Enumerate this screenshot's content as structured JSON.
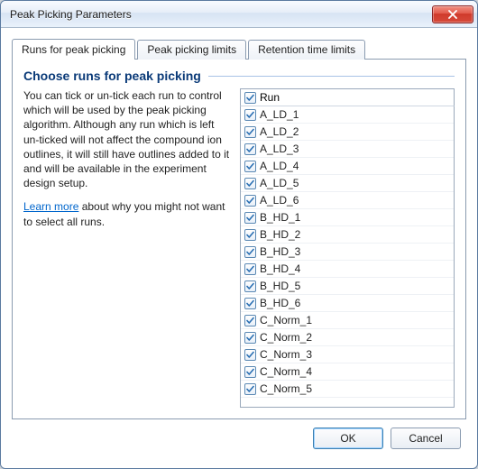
{
  "window": {
    "title": "Peak Picking Parameters"
  },
  "tabs": [
    {
      "label": "Runs for peak picking",
      "active": true
    },
    {
      "label": "Peak picking limits",
      "active": false
    },
    {
      "label": "Retention time limits",
      "active": false
    }
  ],
  "content": {
    "heading": "Choose runs for peak picking",
    "description": "You can tick or un-tick each run to control which will be used by the peak picking algorithm. Although any run which is left un-ticked will not affect the compound ion outlines, it will still have outlines added to it and will be available in the experiment design setup.",
    "learn_more_label": "Learn more",
    "learn_more_suffix": " about why you might not want to select all runs."
  },
  "list": {
    "header_label": "Run",
    "header_checked": true,
    "items": [
      {
        "label": "A_LD_1",
        "checked": true
      },
      {
        "label": "A_LD_2",
        "checked": true
      },
      {
        "label": "A_LD_3",
        "checked": true
      },
      {
        "label": "A_LD_4",
        "checked": true
      },
      {
        "label": "A_LD_5",
        "checked": true
      },
      {
        "label": "A_LD_6",
        "checked": true
      },
      {
        "label": "B_HD_1",
        "checked": true
      },
      {
        "label": "B_HD_2",
        "checked": true
      },
      {
        "label": "B_HD_3",
        "checked": true
      },
      {
        "label": "B_HD_4",
        "checked": true
      },
      {
        "label": "B_HD_5",
        "checked": true
      },
      {
        "label": "B_HD_6",
        "checked": true
      },
      {
        "label": "C_Norm_1",
        "checked": true
      },
      {
        "label": "C_Norm_2",
        "checked": true
      },
      {
        "label": "C_Norm_3",
        "checked": true
      },
      {
        "label": "C_Norm_4",
        "checked": true
      },
      {
        "label": "C_Norm_5",
        "checked": true
      }
    ]
  },
  "buttons": {
    "ok": "OK",
    "cancel": "Cancel"
  }
}
